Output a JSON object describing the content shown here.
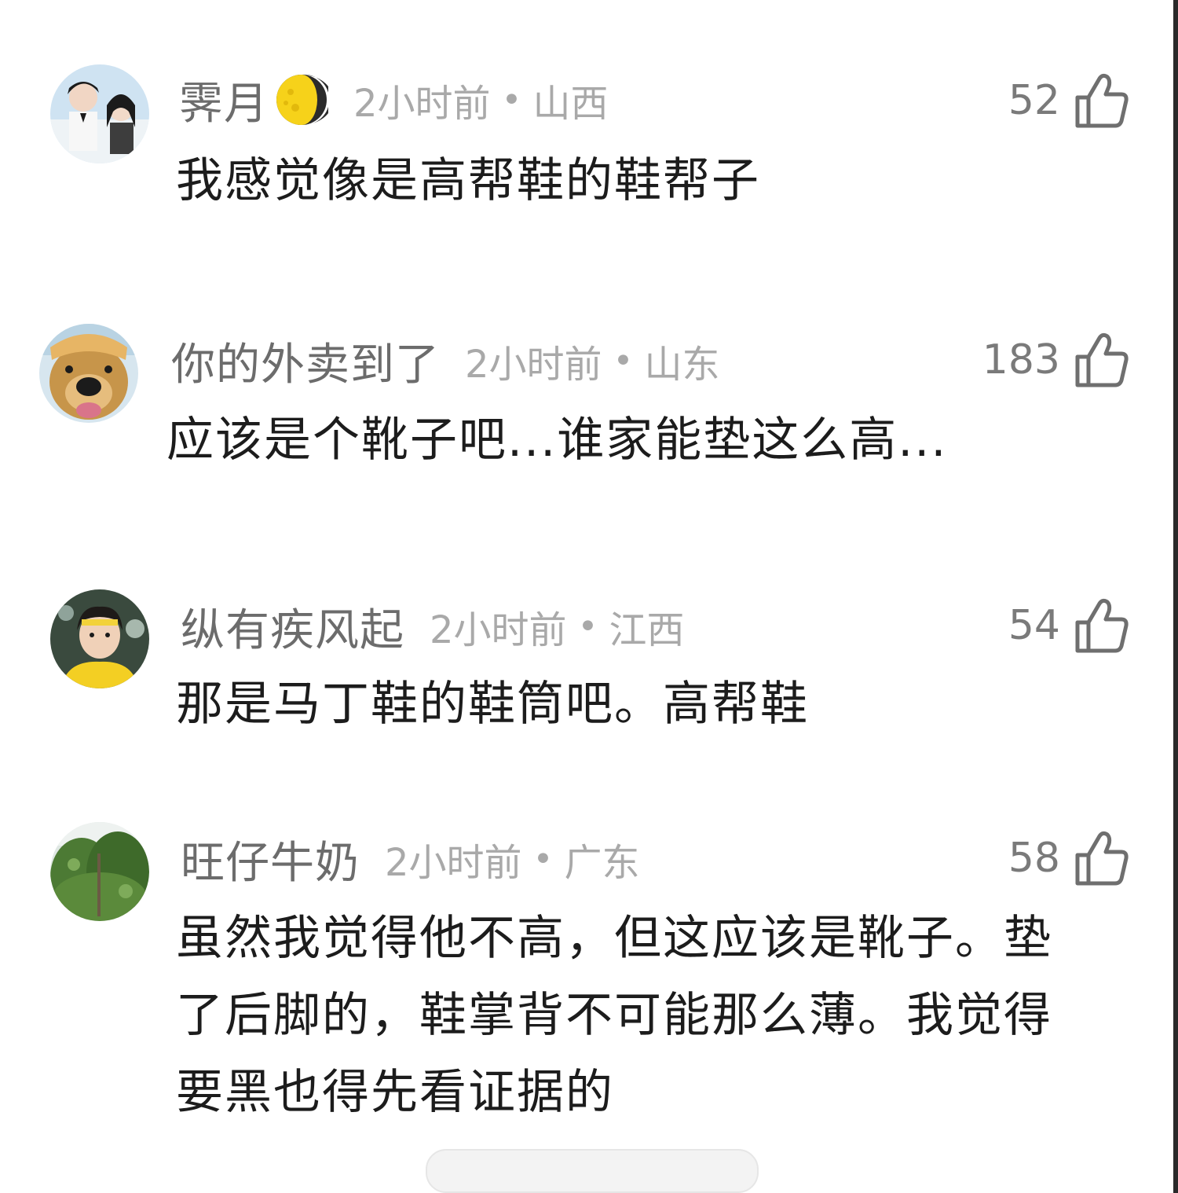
{
  "comments": [
    {
      "username": "霁月",
      "badge_icon": "moon-emoji",
      "time": "2小时前",
      "separator": "•",
      "region": "山西",
      "likes": "52",
      "text": "我感觉像是高帮鞋的鞋帮子"
    },
    {
      "username": "你的外卖到了",
      "time": "2小时前",
      "separator": "•",
      "region": "山东",
      "likes": "183",
      "text": "应该是个靴子吧...谁家能垫这么高..."
    },
    {
      "username": "纵有疾风起",
      "time": "2小时前",
      "separator": "•",
      "region": "江西",
      "likes": "54",
      "text": "那是马丁鞋的鞋筒吧。高帮鞋"
    },
    {
      "username": "旺仔牛奶",
      "time": "2小时前",
      "separator": "•",
      "region": "广东",
      "likes": "58",
      "text_lines": [
        "虽然我觉得他不高，但这应该是靴子。垫",
        "了后脚的，鞋掌背不可能那么薄。我觉得",
        "要黑也得先看证据的"
      ]
    }
  ],
  "icons": {
    "like": "thumbs-up-outline-icon"
  },
  "colors": {
    "username": "#6c6c6c",
    "meta": "#a9a9a9",
    "text": "#1c1c1c",
    "like": "#7a7a7a"
  }
}
